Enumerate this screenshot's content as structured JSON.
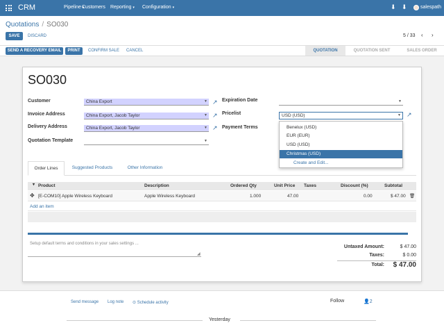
{
  "navbar": {
    "app_name": "CRM",
    "menus": [
      "Pipeline",
      "Customers",
      "Reporting",
      "Configuration"
    ],
    "user": "salespath"
  },
  "breadcrumb": {
    "parent": "Quotations",
    "separator": "/",
    "current": "SO030"
  },
  "toolbar": {
    "save": "SAVE",
    "discard": "DISCARD"
  },
  "pager": {
    "text": "5 / 33"
  },
  "actions": {
    "recovery_email": "SEND A RECOVERY EMAIL",
    "print": "PRINT",
    "confirm": "CONFIRM SALE",
    "cancel": "CANCEL"
  },
  "stages": [
    "QUOTATION",
    "QUOTATION SENT",
    "SALES ORDER"
  ],
  "form": {
    "title": "SO030",
    "customer_label": "Customer",
    "customer_value": "China Export",
    "invoice_label": "Invoice Address",
    "invoice_value": "China Export, Jacob Taylor",
    "delivery_label": "Delivery Address",
    "delivery_value": "China Export, Jacob Taylor",
    "template_label": "Quotation Template",
    "template_value": "",
    "expiration_label": "Expiration Date",
    "expiration_value": "",
    "pricelist_label": "Pricelist",
    "pricelist_value": "USD (USD)",
    "payment_label": "Payment Terms"
  },
  "pricelist_dropdown": {
    "options": [
      "Benelux (USD)",
      "EUR (EUR)",
      "USD (USD)",
      "Christmas (USD)"
    ],
    "selected": "Christmas (USD)",
    "create": "Create and Edit..."
  },
  "tabs": [
    "Order Lines",
    "Suggested Products",
    "Other Information"
  ],
  "table": {
    "columns": [
      "Product",
      "Description",
      "Ordered Qty",
      "Unit Price",
      "Taxes",
      "Discount (%)",
      "Subtotal"
    ],
    "rows": [
      {
        "product": "[E-COM10] Apple Wireless Keyboard",
        "description": "Apple Wireless Keyboard",
        "qty": "1.000",
        "unit_price": "47.00",
        "taxes": "",
        "discount": "0.00",
        "subtotal": "$ 47.00"
      }
    ],
    "add_item": "Add an item"
  },
  "notes_placeholder": "Setup default terms and conditions in your sales settings ...",
  "totals": {
    "untaxed_label": "Untaxed Amount:",
    "untaxed_value": "$ 47.00",
    "taxes_label": "Taxes:",
    "taxes_value": "$ 0.00",
    "total_label": "Total:",
    "total_value": "$ 47.00"
  },
  "chatter": {
    "send_message": "Send message",
    "log_note": "Log note",
    "schedule": "Schedule activity",
    "follow": "Follow",
    "followers": "2",
    "date_sep": "Yesterday"
  },
  "colors": {
    "brand": "#3a74a8",
    "required_field": "#d2d2ff"
  }
}
